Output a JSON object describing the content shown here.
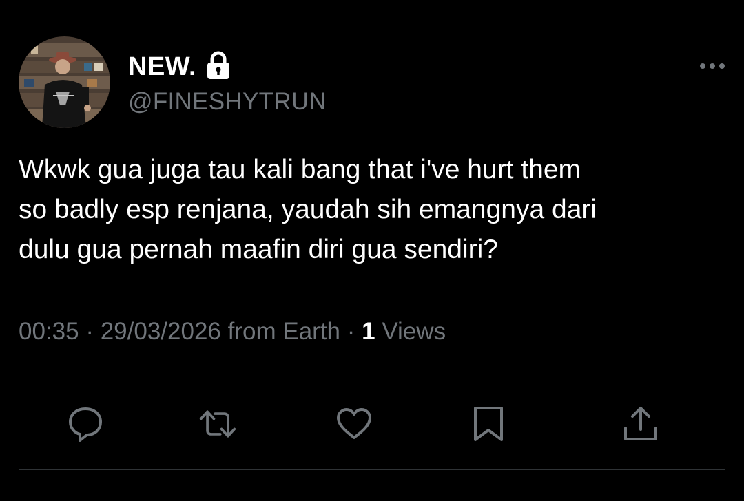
{
  "user": {
    "display_name": "NEW.",
    "handle": "@FINESHYTRUN",
    "protected_icon": "lock-icon",
    "avatar": "profile-photo"
  },
  "tweet": {
    "text": "Wkwk gua juga tau kali bang that i've hurt them\nso badly esp renjana, yaudah sih emangnya dari\ndulu gua pernah maafin diri gua sendiri?",
    "time": "00:35",
    "separator": "·",
    "date": "29/03/2026",
    "source": "from Earth",
    "views_count": "1",
    "views_label": "Views"
  },
  "actions": {
    "more": "more-icon",
    "reply": "reply-icon",
    "retweet": "retweet-icon",
    "like": "heart-icon",
    "bookmark": "bookmark-icon",
    "share": "share-icon"
  },
  "colors": {
    "background": "#000000",
    "text_primary": "#ffffff",
    "text_secondary": "#71767b",
    "divider": "#2f3336",
    "icon": "#71767b"
  }
}
